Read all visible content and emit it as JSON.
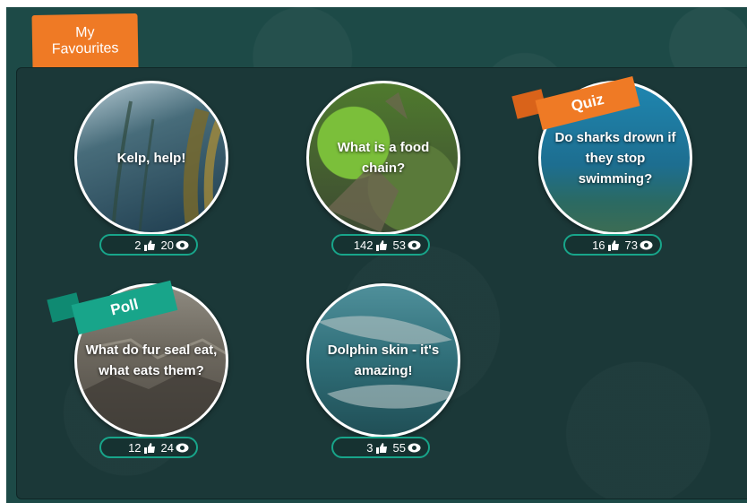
{
  "header": {
    "title_line1": "My",
    "title_line2": "Favourites"
  },
  "colors": {
    "accent_orange": "#ef7a25",
    "accent_teal": "#18a58a",
    "panel": "#1b3838"
  },
  "cards": [
    {
      "title": "Kelp, help!",
      "likes": "2",
      "views": "20",
      "tag": ""
    },
    {
      "title": "What is a food chain?",
      "likes": "142",
      "views": "53",
      "tag": ""
    },
    {
      "title": "Do sharks drown if they stop swimming?",
      "likes": "16",
      "views": "73",
      "tag": "Quiz"
    },
    {
      "title": "What do fur seal eat, what eats them?",
      "likes": "12",
      "views": "24",
      "tag": "Poll"
    },
    {
      "title": "Dolphin skin - it's amazing!",
      "likes": "3",
      "views": "55",
      "tag": ""
    }
  ],
  "icons": {
    "like": "thumbs-up-icon",
    "views": "eye-icon"
  }
}
